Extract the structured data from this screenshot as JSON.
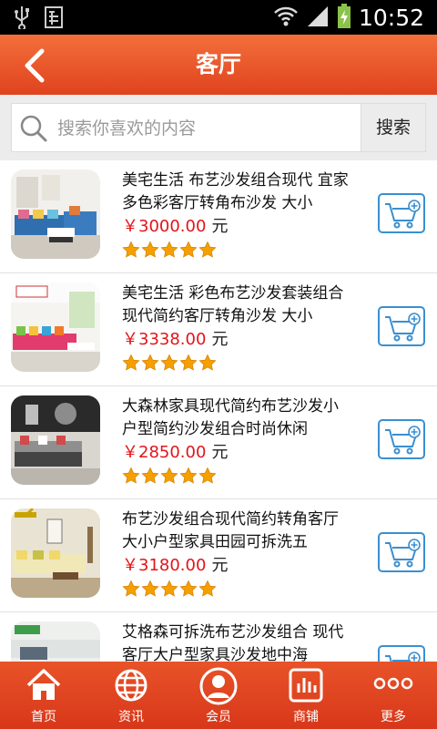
{
  "status_bar": {
    "time": "10:52",
    "left_icons": [
      "usb-icon",
      "sim-icon"
    ],
    "right_icons": [
      "wifi-icon",
      "signal-icon",
      "battery-charging-icon"
    ]
  },
  "header": {
    "title": "客厅",
    "back_icon": "chevron-left-icon"
  },
  "search": {
    "placeholder": "搜索你喜欢的内容",
    "button_label": "搜索"
  },
  "products": [
    {
      "title": "美宅生活 布艺沙发组合现代 宜家多色彩客厅转角布沙发 大小",
      "price": "￥3000.00",
      "unit": "元",
      "rating": 5
    },
    {
      "title": "美宅生活 彩色布艺沙发套装组合 现代简约客厅转角沙发 大小",
      "price": "￥3338.00",
      "unit": "元",
      "rating": 5
    },
    {
      "title": "大森林家具现代简约布艺沙发小户型简约沙发组合时尚休闲",
      "price": "￥2850.00",
      "unit": "元",
      "rating": 5
    },
    {
      "title": "布艺沙发组合现代简约转角客厅大小户型家具田园可拆洗五",
      "price": "￥3180.00",
      "unit": "元",
      "rating": 5
    },
    {
      "title": "艾格森可拆洗布艺沙发组合 现代客厅大户型家具沙发地中海",
      "price": "",
      "unit": "",
      "rating": 0
    }
  ],
  "bottom_nav": [
    {
      "label": "首页",
      "icon": "home-icon"
    },
    {
      "label": "资讯",
      "icon": "globe-icon"
    },
    {
      "label": "会员",
      "icon": "member-icon"
    },
    {
      "label": "商铺",
      "icon": "shop-icon"
    },
    {
      "label": "更多",
      "icon": "more-icon"
    }
  ],
  "colors": {
    "header": "#e94a22",
    "price": "#e3141a",
    "cart_border": "#3a8fd0",
    "star": "#f5a000"
  }
}
